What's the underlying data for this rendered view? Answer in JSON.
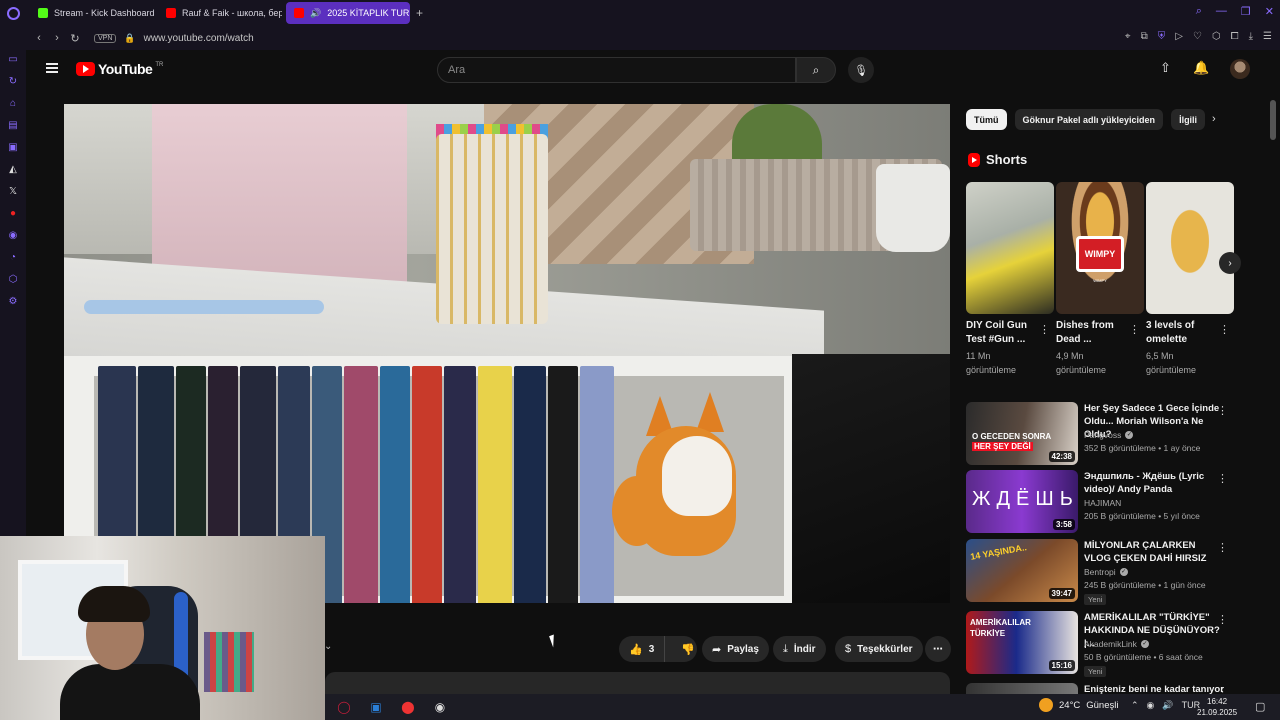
{
  "browser": {
    "tabs": [
      {
        "label": "Stream - Kick Dashboard",
        "icon": "kick-icon"
      },
      {
        "label": "Rauf & Faik - школа, бер",
        "icon": "youtube-icon"
      },
      {
        "label": "2025 KİTAPLIK TURU",
        "icon": "youtube-icon",
        "active": true
      }
    ],
    "new_tab": "+",
    "vpn_label": "VPN",
    "url": "www.youtube.com/watch"
  },
  "youtube": {
    "logo_text": "YouTube",
    "logo_region": "TR",
    "search_placeholder": "Ara"
  },
  "actions": {
    "like_count": "3",
    "share_label": "Paylaş",
    "download_label": "İndir",
    "thanks_label": "Teşekkürler"
  },
  "chips": [
    "Tümü",
    "Göknur Pakel adlı yükleyiciden",
    "İlgili"
  ],
  "shorts": {
    "title": "Shorts",
    "items": [
      {
        "title": "DIY Coil Gun Test #Gun ...",
        "views": "11 Mn görüntüleme"
      },
      {
        "title": "Dishes from Dead ...",
        "views": "4,9 Mn görüntüleme",
        "badge": "WIMPY",
        "badge_sub": "WIMPY"
      },
      {
        "title": "3 levels of omelette",
        "views": "6,5 Mn görüntüleme"
      }
    ]
  },
  "recommendations": [
    {
      "title": "Her Şey Sadece 1 Gece İçinde Oldu... Moriah Wilson'a Ne Oldu?",
      "channel": "Pangvoss",
      "verified": true,
      "meta": "352 B görüntüleme • 1 ay önce",
      "duration": "42:38",
      "thumb_text_1": "O GECEDEN SONRA",
      "thumb_text_2": "HER ŞEY DEĞİ"
    },
    {
      "title": "Эндшпиль - Ждёшь (Lyric video)/ Andy Panda",
      "channel": "HAJIMAN",
      "verified": false,
      "meta": "205 B görüntüleme • 5 yıl önce",
      "duration": "3:58",
      "thumb_text_1": "ЖДЁШЬ"
    },
    {
      "title": "MİLYONLAR ÇALARKEN VLOG ÇEKEN DAHİ HIRSIZ",
      "channel": "Bentropi",
      "verified": true,
      "meta": "245 B görüntüleme • 1 gün önce",
      "duration": "39:47",
      "badge": "Yeni",
      "thumb_text_1": "14 YAŞINDA.."
    },
    {
      "title": "AMERİKALILAR \"TÜRKİYE\" HAKKINDA NE DÜŞÜNÜYOR? |...",
      "channel": "AkademikLink",
      "verified": true,
      "meta": "50 B görüntüleme • 6 saat önce",
      "duration": "15:16",
      "badge": "Yeni",
      "thumb_text_1": "AMERİKALILAR",
      "thumb_text_2": "TÜRKİYE"
    },
    {
      "title": "Enişteniz beni ne kadar tanıyor",
      "channel": "",
      "verified": false,
      "meta": "",
      "duration": ""
    }
  ],
  "taskbar": {
    "temperature": "24°C",
    "weather": "Güneşli",
    "language": "TUR",
    "time": "16:42",
    "date": "21.09.2025"
  },
  "colors": {
    "background": "#0f0f0f",
    "browser_accent": "#5b2fbf",
    "youtube_red": "#ff0000"
  }
}
